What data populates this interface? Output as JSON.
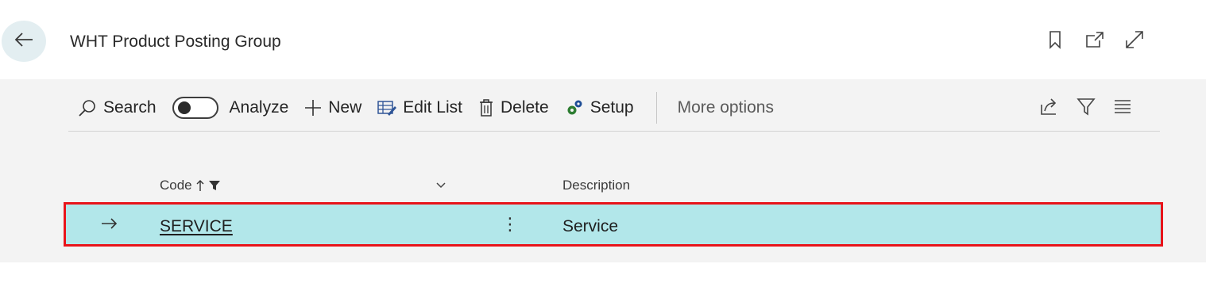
{
  "header": {
    "title": "WHT Product Posting Group",
    "icons": [
      "bookmark-icon",
      "open-new-window-icon",
      "expand-icon"
    ]
  },
  "toolbar": {
    "search_label": "Search",
    "analyze_label": "Analyze",
    "analyze_on": false,
    "new_label": "New",
    "edit_list_label": "Edit List",
    "delete_label": "Delete",
    "setup_label": "Setup",
    "more_options_label": "More options",
    "right_icons": [
      "share-icon",
      "filter-icon",
      "list-view-icon"
    ]
  },
  "table": {
    "columns": [
      {
        "label": "Code",
        "sort": "ascending",
        "filtered": true
      },
      {
        "label": "Description"
      }
    ],
    "rows": [
      {
        "code": "SERVICE",
        "description": "Service",
        "selected": true
      }
    ]
  },
  "colors": {
    "selected_row": "#b2e7ea",
    "highlight_border": "#e8141a",
    "panel_bg": "#f3f3f3",
    "back_button_bg": "#e3eef1"
  }
}
